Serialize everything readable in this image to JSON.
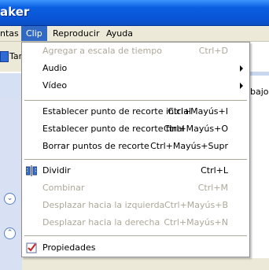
{
  "window": {
    "title": "aker"
  },
  "menubar": {
    "items": [
      {
        "label": "ntas"
      },
      {
        "label": "Clip"
      },
      {
        "label": "Reproducir"
      },
      {
        "label": "Ayuda"
      }
    ]
  },
  "background": {
    "tasks_label": "Tar",
    "right_text": "bajo.",
    "scroll_down_glyph": "⌄",
    "scroll_up_glyph": "⌃"
  },
  "clip_menu": {
    "items": [
      {
        "label": "Agregar a escala de tiempo",
        "shortcut": "Ctrl+D",
        "disabled": true
      },
      {
        "label": "Audio",
        "submenu": true
      },
      {
        "label": "Vídeo",
        "submenu": true
      },
      {
        "label": "Establecer punto de recorte inicial",
        "shortcut": "Ctrl+Mayús+I"
      },
      {
        "label": "Establecer punto de recorte final",
        "shortcut": "Ctrl+Mayús+O"
      },
      {
        "label": "Borrar puntos de recorte",
        "shortcut": "Ctrl+Mayús+Supr"
      },
      {
        "label": "Dividir",
        "shortcut": "Ctrl+L",
        "icon": "split-icon"
      },
      {
        "label": "Combinar",
        "shortcut": "Ctrl+M",
        "disabled": true
      },
      {
        "label": "Desplazar hacia la izquierda",
        "shortcut": "Ctrl+Mayús+B",
        "disabled": true
      },
      {
        "label": "Desplazar hacia la derecha",
        "shortcut": "Ctrl+Mayús+N",
        "disabled": true
      },
      {
        "label": "Propiedades",
        "icon": "properties-check-icon"
      }
    ]
  },
  "colors": {
    "title_bar": "#0a55d8",
    "menu_highlight": "#316ac5",
    "disabled_text": "#aca899",
    "menubar_bg": "#ece9d8"
  }
}
